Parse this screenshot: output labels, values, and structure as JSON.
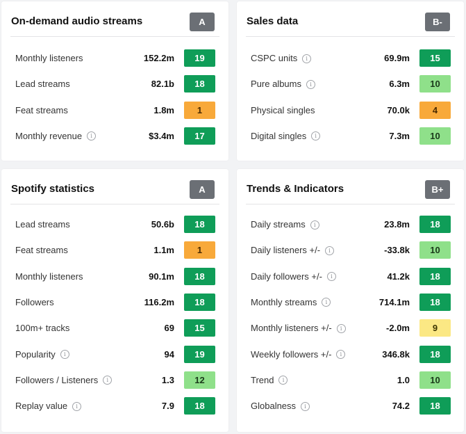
{
  "score_colors": {
    "green": "#0f9d58",
    "lightgreen": "#8fe08a",
    "orange": "#f8a93a",
    "yellow": "#fbe884",
    "grade_badge": "#6b6f75"
  },
  "cards": [
    {
      "title": "On-demand audio streams",
      "grade": "A",
      "rows": [
        {
          "label": "Monthly listeners",
          "info": false,
          "value": "152.2m",
          "score": "19",
          "level": "green"
        },
        {
          "label": "Lead streams",
          "info": false,
          "value": "82.1b",
          "score": "18",
          "level": "green"
        },
        {
          "label": "Feat streams",
          "info": false,
          "value": "1.8m",
          "score": "1",
          "level": "orange"
        },
        {
          "label": "Monthly revenue",
          "info": true,
          "value": "$3.4m",
          "score": "17",
          "level": "green"
        }
      ]
    },
    {
      "title": "Sales data",
      "grade": "B-",
      "rows": [
        {
          "label": "CSPC units",
          "info": true,
          "value": "69.9m",
          "score": "15",
          "level": "green"
        },
        {
          "label": "Pure albums",
          "info": true,
          "value": "6.3m",
          "score": "10",
          "level": "lightgreen"
        },
        {
          "label": "Physical singles",
          "info": false,
          "value": "70.0k",
          "score": "4",
          "level": "orange"
        },
        {
          "label": "Digital singles",
          "info": true,
          "value": "7.3m",
          "score": "10",
          "level": "lightgreen"
        }
      ]
    },
    {
      "title": "Spotify statistics",
      "grade": "A",
      "rows": [
        {
          "label": "Lead streams",
          "info": false,
          "value": "50.6b",
          "score": "18",
          "level": "green"
        },
        {
          "label": "Feat streams",
          "info": false,
          "value": "1.1m",
          "score": "1",
          "level": "orange"
        },
        {
          "label": "Monthly listeners",
          "info": false,
          "value": "90.1m",
          "score": "18",
          "level": "green"
        },
        {
          "label": "Followers",
          "info": false,
          "value": "116.2m",
          "score": "18",
          "level": "green"
        },
        {
          "label": "100m+ tracks",
          "info": false,
          "value": "69",
          "score": "15",
          "level": "green"
        },
        {
          "label": "Popularity",
          "info": true,
          "value": "94",
          "score": "19",
          "level": "green"
        },
        {
          "label": "Followers / Listeners",
          "info": true,
          "value": "1.3",
          "score": "12",
          "level": "lightgreen"
        },
        {
          "label": "Replay value",
          "info": true,
          "value": "7.9",
          "score": "18",
          "level": "green"
        }
      ]
    },
    {
      "title": "Trends & Indicators",
      "grade": "B+",
      "rows": [
        {
          "label": "Daily streams",
          "info": true,
          "value": "23.8m",
          "score": "18",
          "level": "green"
        },
        {
          "label": "Daily listeners +/-",
          "info": true,
          "value": "-33.8k",
          "score": "10",
          "level": "lightgreen"
        },
        {
          "label": "Daily followers +/-",
          "info": true,
          "value": "41.2k",
          "score": "18",
          "level": "green"
        },
        {
          "label": "Monthly streams",
          "info": true,
          "value": "714.1m",
          "score": "18",
          "level": "green"
        },
        {
          "label": "Monthly listeners +/-",
          "info": true,
          "value": "-2.0m",
          "score": "9",
          "level": "yellow"
        },
        {
          "label": "Weekly followers +/-",
          "info": true,
          "value": "346.8k",
          "score": "18",
          "level": "green"
        },
        {
          "label": "Trend",
          "info": true,
          "value": "1.0",
          "score": "10",
          "level": "lightgreen"
        },
        {
          "label": "Globalness",
          "info": true,
          "value": "74.2",
          "score": "18",
          "level": "green"
        }
      ]
    }
  ]
}
